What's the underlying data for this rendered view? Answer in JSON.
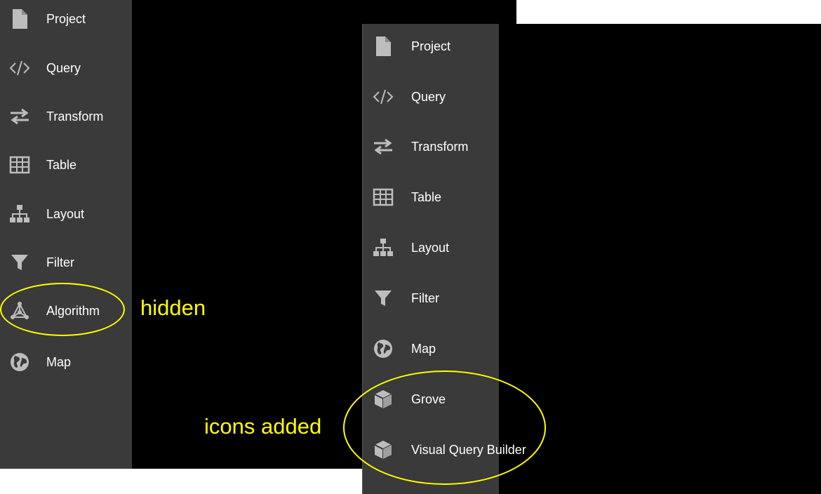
{
  "colors": {
    "sidebar_bg": "#3a3a3a",
    "icon": "#bdbdbd",
    "text": "#ffffff",
    "annotation": "#ffff00"
  },
  "left_panel": {
    "items": [
      {
        "label": "Project",
        "icon": "file-icon"
      },
      {
        "label": "Query",
        "icon": "code-icon"
      },
      {
        "label": "Transform",
        "icon": "transfer-arrows-icon"
      },
      {
        "label": "Table",
        "icon": "table-icon"
      },
      {
        "label": "Layout",
        "icon": "hierarchy-icon"
      },
      {
        "label": "Filter",
        "icon": "filter-icon"
      },
      {
        "label": "Algorithm",
        "icon": "network-icon"
      },
      {
        "label": "Map",
        "icon": "globe-icon"
      }
    ]
  },
  "right_panel": {
    "items": [
      {
        "label": "Project",
        "icon": "file-icon"
      },
      {
        "label": "Query",
        "icon": "code-icon"
      },
      {
        "label": "Transform",
        "icon": "transfer-arrows-icon"
      },
      {
        "label": "Table",
        "icon": "table-icon"
      },
      {
        "label": "Layout",
        "icon": "hierarchy-icon"
      },
      {
        "label": "Filter",
        "icon": "filter-icon"
      },
      {
        "label": "Map",
        "icon": "globe-icon"
      },
      {
        "label": "Grove",
        "icon": "cube-icon"
      },
      {
        "label": "Visual Query Builder",
        "icon": "cube-icon"
      }
    ]
  },
  "annotations": {
    "hidden": "hidden",
    "icons_added": "icons added"
  }
}
